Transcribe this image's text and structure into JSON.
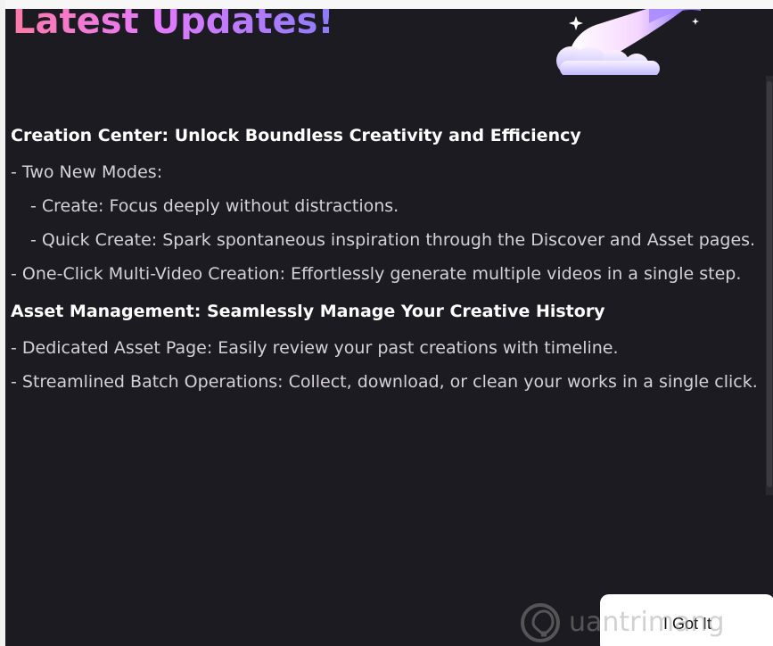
{
  "dialog": {
    "title": "Latest Updates!"
  },
  "sections": [
    {
      "title": "Creation Center: Unlock Boundless Creativity and Efficiency",
      "lines": [
        "- Two New Modes:",
        "  - Create: Focus deeply without distractions.",
        "  - Quick Create: Spark spontaneous inspiration through the Discover and Asset pages.",
        "- One-Click Multi-Video Creation: Effortlessly generate multiple videos in a single step."
      ]
    },
    {
      "title": "Asset Management: Seamlessly Manage Your Creative History",
      "lines": [
        "- Dedicated Asset Page: Easily review your past creations with timeline.",
        "- Streamlined Batch Operations: Collect, download, or clean your works in a single click."
      ]
    }
  ],
  "buttons": {
    "got_it": "I Got It"
  },
  "watermark": {
    "text": "uantrimang"
  }
}
